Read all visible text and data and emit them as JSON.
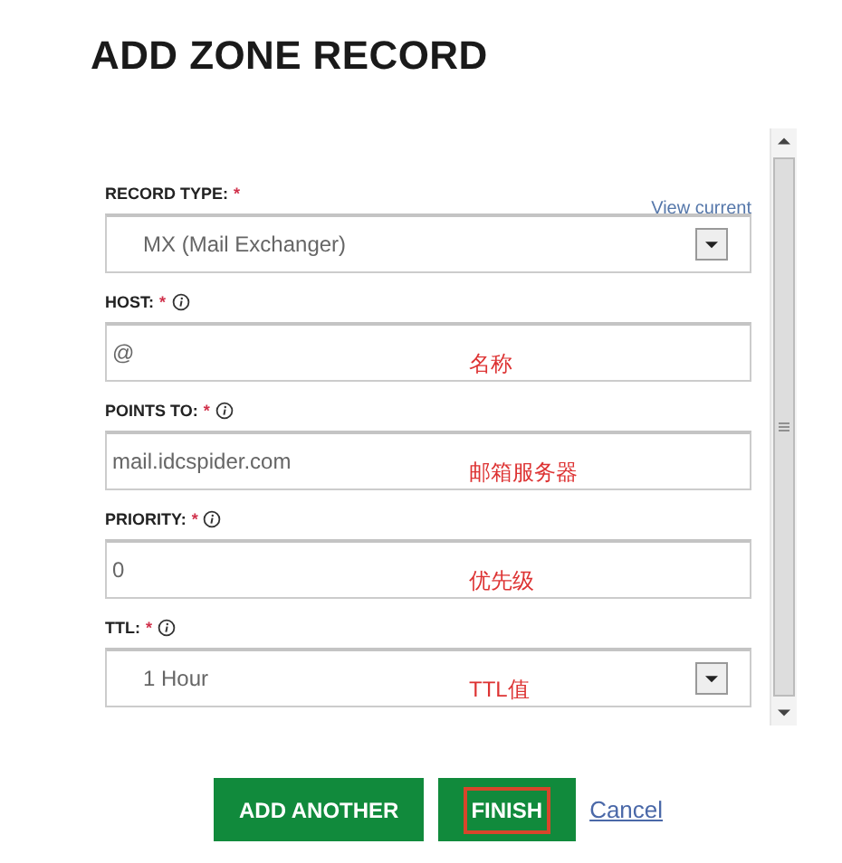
{
  "title": "ADD ZONE RECORD",
  "link": "View current",
  "fields": [
    {
      "kind": "select",
      "label": "RECORD TYPE:",
      "required": "*",
      "info": false,
      "value": "MX (Mail Exchanger)"
    },
    {
      "kind": "text",
      "label": "HOST:",
      "required": "*",
      "info": true,
      "value": "@",
      "annotation": "名称"
    },
    {
      "kind": "text",
      "label": "POINTS TO:",
      "required": "*",
      "info": true,
      "value": "mail.idcspider.com",
      "annotation": "邮箱服务器"
    },
    {
      "kind": "text",
      "label": "PRIORITY:",
      "required": "*",
      "info": true,
      "value": "0",
      "annotation": "优先级"
    },
    {
      "kind": "select",
      "label": "TTL:",
      "required": "*",
      "info": true,
      "value": "1 Hour",
      "annotation": "TTL值"
    }
  ],
  "buttons": [
    {
      "kind": "button",
      "label": "ADD ANOTHER",
      "highlighted": false
    },
    {
      "kind": "button",
      "label": "FINISH",
      "highlighted": true
    },
    {
      "kind": "link",
      "label": "Cancel",
      "highlighted": false
    }
  ]
}
